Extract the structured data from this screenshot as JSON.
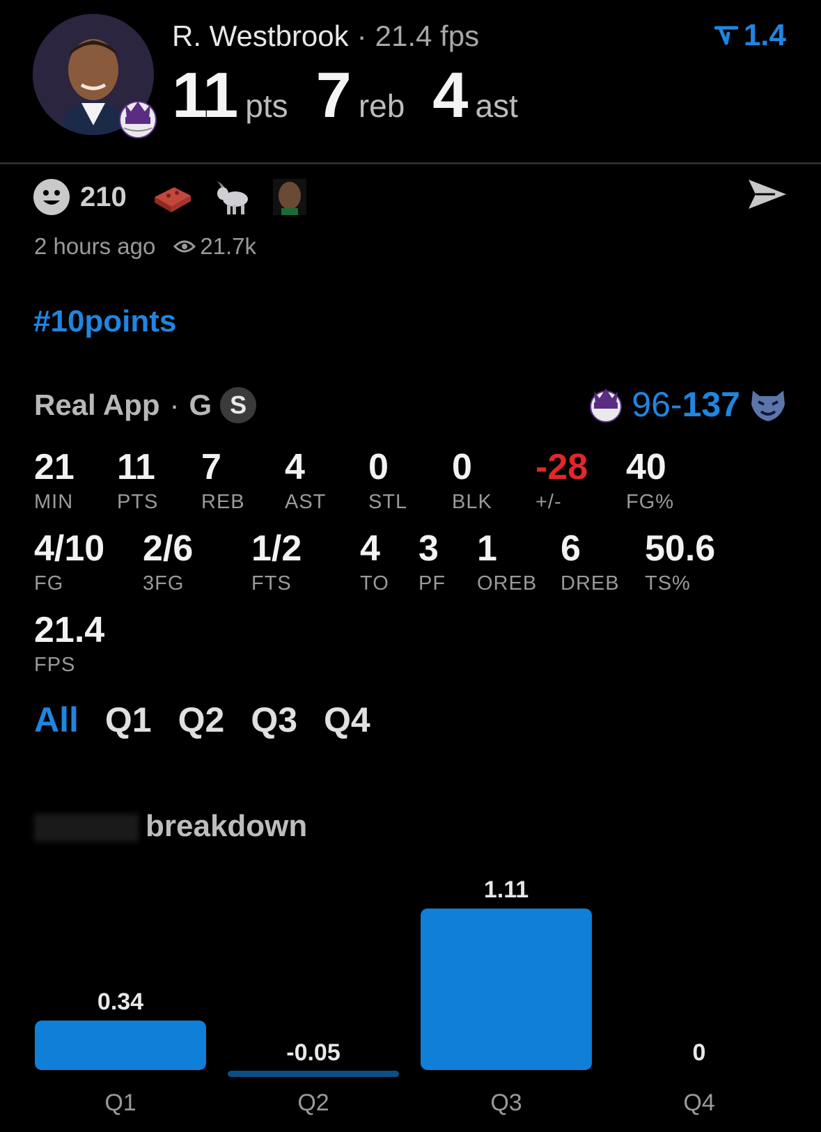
{
  "header": {
    "player_name": "R. Westbrook",
    "separator": "·",
    "fps": "21.4 fps",
    "trend_value": "1.4",
    "stats": [
      {
        "value": "11",
        "unit": "pts"
      },
      {
        "value": "7",
        "unit": "reb"
      },
      {
        "value": "4",
        "unit": "ast"
      }
    ]
  },
  "reactions": {
    "count": "210",
    "timestamp": "2 hours ago",
    "views": "21.7k"
  },
  "hashtag": "#10points",
  "source": {
    "app": "Real App",
    "separator": "·",
    "position": "G",
    "badge": "S"
  },
  "game": {
    "score_low": "96",
    "dash": "-",
    "score_high": "137"
  },
  "stat_rows": [
    [
      {
        "value": "21",
        "label": "MIN"
      },
      {
        "value": "11",
        "label": "PTS"
      },
      {
        "value": "7",
        "label": "REB"
      },
      {
        "value": "4",
        "label": "AST"
      },
      {
        "value": "0",
        "label": "STL"
      },
      {
        "value": "0",
        "label": "BLK"
      },
      {
        "value": "-28",
        "label": "+/-"
      },
      {
        "value": "40",
        "label": "FG%"
      }
    ],
    [
      {
        "value": "4/10",
        "label": "FG"
      },
      {
        "value": "2/6",
        "label": "3FG"
      },
      {
        "value": "1/2",
        "label": "FTS"
      },
      {
        "value": "4",
        "label": "TO"
      },
      {
        "value": "3",
        "label": "PF"
      },
      {
        "value": "1",
        "label": "OREB"
      },
      {
        "value": "6",
        "label": "DREB"
      },
      {
        "value": "50.6",
        "label": "TS%"
      }
    ],
    [
      {
        "value": "21.4",
        "label": "FPS"
      }
    ]
  ],
  "tabs": [
    "All",
    "Q1",
    "Q2",
    "Q3",
    "Q4"
  ],
  "section_title": "breakdown",
  "colors": {
    "accent": "#1f86e0",
    "negative": "#e3262b",
    "bar": "#0f7fd8",
    "negative_bar": "#0c4e86"
  },
  "chart_data": {
    "type": "bar",
    "categories": [
      "Q1",
      "Q2",
      "Q3",
      "Q4"
    ],
    "values": [
      0.34,
      -0.05,
      1.11,
      0
    ],
    "data_labels": [
      "0.34",
      "-0.05",
      "1.11",
      "0"
    ]
  }
}
